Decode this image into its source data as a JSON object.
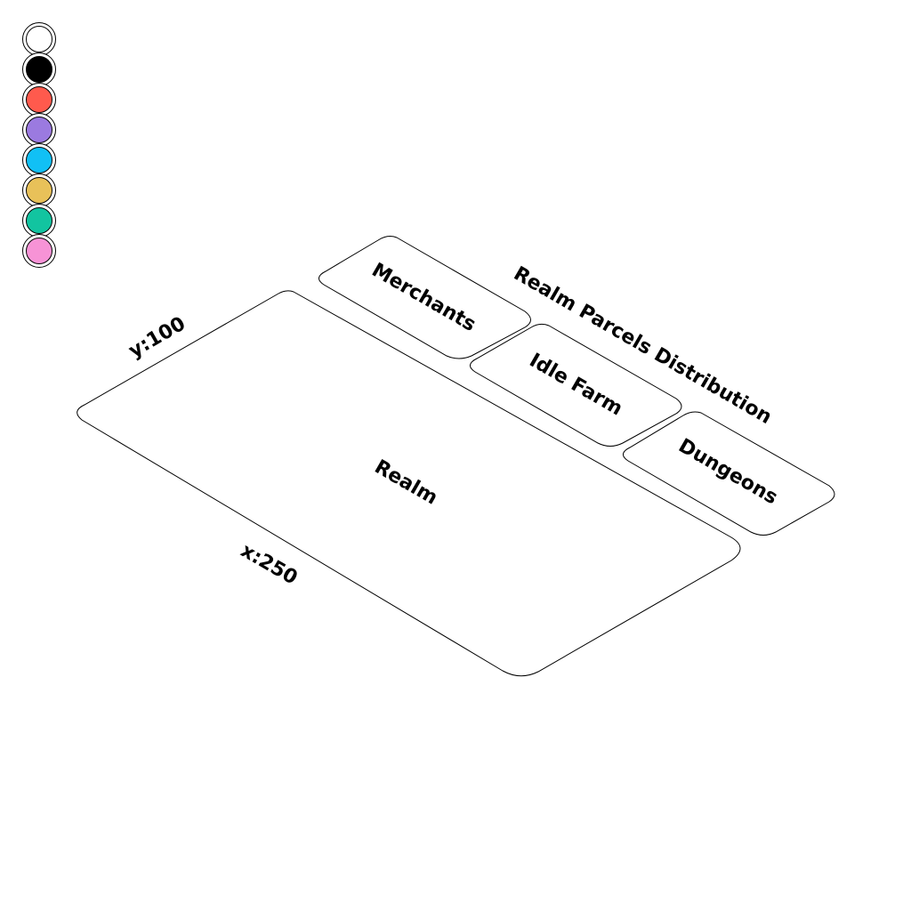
{
  "palette": {
    "colors": [
      {
        "name": "white-swatch",
        "hex": "#ffffff"
      },
      {
        "name": "black-swatch",
        "hex": "#000000"
      },
      {
        "name": "red-swatch",
        "hex": "#ff5a4d"
      },
      {
        "name": "purple-swatch",
        "hex": "#9b7ae0"
      },
      {
        "name": "blue-swatch",
        "hex": "#11c0f5"
      },
      {
        "name": "yellow-swatch",
        "hex": "#e8c159"
      },
      {
        "name": "teal-swatch",
        "hex": "#12c4a0"
      },
      {
        "name": "pink-swatch",
        "hex": "#f793d6"
      }
    ]
  },
  "diagram": {
    "title": "Realm Parcels Distribution",
    "main_block": {
      "label": "Realm"
    },
    "y_dimension": "y:100",
    "x_dimension": "x:250",
    "parcels": [
      {
        "label": "Merchants"
      },
      {
        "label": "Idle Farm"
      },
      {
        "label": "Dungeons"
      }
    ]
  }
}
